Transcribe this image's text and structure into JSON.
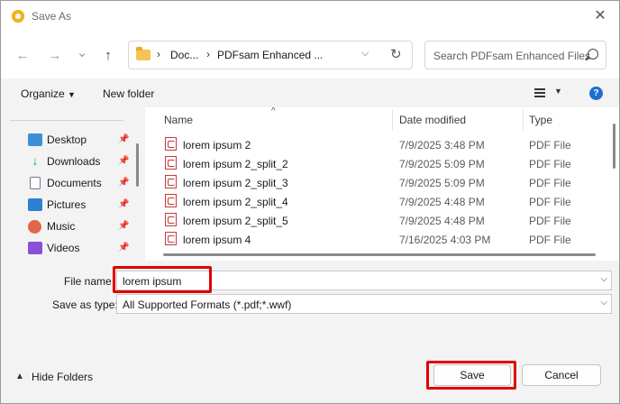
{
  "window": {
    "title": "Save As",
    "app_icon": "pdfsam-icon"
  },
  "nav": {
    "back": "←",
    "forward": "→",
    "recent": "⌄",
    "up": "↑",
    "breadcrumbs": [
      "Doc...",
      "PDFsam Enhanced ..."
    ],
    "separator": "›",
    "search_placeholder": "Search PDFsam Enhanced Files"
  },
  "toolbar": {
    "organize": "Organize",
    "new_folder": "New folder",
    "help": "?"
  },
  "sidebar": {
    "items": [
      {
        "label": "Desktop",
        "icon": "desktop-icon",
        "color": "#3a8fd6"
      },
      {
        "label": "Downloads",
        "icon": "download-icon",
        "color": "#2a9d6a"
      },
      {
        "label": "Documents",
        "icon": "documents-icon",
        "color": "#6c7b8a"
      },
      {
        "label": "Pictures",
        "icon": "pictures-icon",
        "color": "#2f7fd2"
      },
      {
        "label": "Music",
        "icon": "music-icon",
        "color": "#e0674a"
      },
      {
        "label": "Videos",
        "icon": "videos-icon",
        "color": "#8a4fd6"
      }
    ]
  },
  "files": {
    "columns": [
      "Name",
      "Date modified",
      "Type"
    ],
    "rows": [
      {
        "name": "lorem ipsum 2",
        "date": "7/9/2025 3:48 PM",
        "type": "PDF File"
      },
      {
        "name": "lorem ipsum 2_split_2",
        "date": "7/9/2025 5:09 PM",
        "type": "PDF File"
      },
      {
        "name": "lorem ipsum 2_split_3",
        "date": "7/9/2025 5:09 PM",
        "type": "PDF File"
      },
      {
        "name": "lorem ipsum 2_split_4",
        "date": "7/9/2025 4:48 PM",
        "type": "PDF File"
      },
      {
        "name": "lorem ipsum 2_split_5",
        "date": "7/9/2025 4:48 PM",
        "type": "PDF File"
      },
      {
        "name": "lorem ipsum 4",
        "date": "7/16/2025 4:03 PM",
        "type": "PDF File"
      }
    ]
  },
  "form": {
    "file_name_label": "File name:",
    "file_name_value": "lorem ipsum",
    "save_type_label": "Save as type:",
    "save_type_value": "All Supported Formats (*.pdf;*.wwf)"
  },
  "footer": {
    "hide_folders": "Hide Folders",
    "save": "Save",
    "cancel": "Cancel"
  },
  "highlight_color": "#e00000"
}
